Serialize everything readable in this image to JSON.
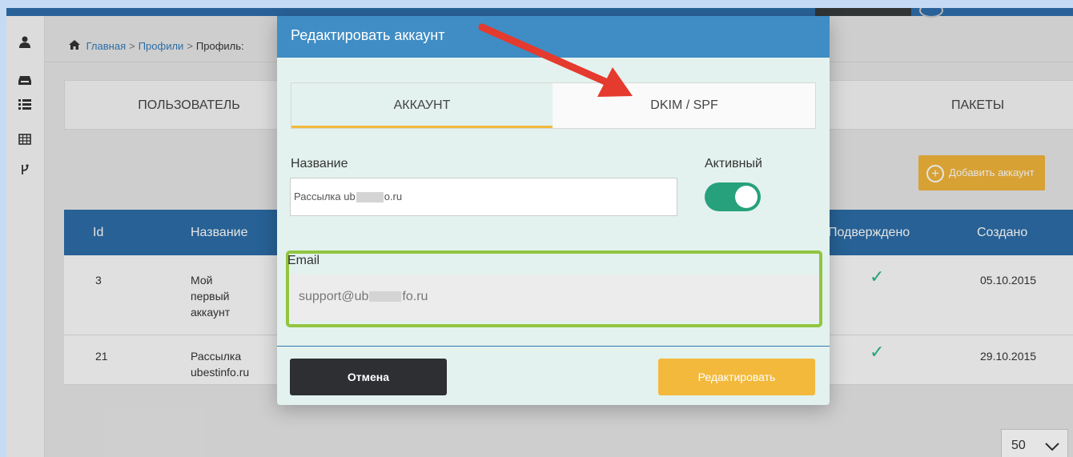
{
  "breadcrumb": {
    "home": "Главная",
    "sep": ">",
    "profiles": "Профили",
    "current": "Профиль:"
  },
  "page_tabs": {
    "user": "ПОЛЬЗОВАТЕЛЬ",
    "packages": "ПАКЕТЫ"
  },
  "add_button": {
    "icon": "plus-circle-icon",
    "label": "Добавить аккаунт"
  },
  "table": {
    "headers": {
      "id": "Id",
      "name": "Название",
      "confirmed": "Подверждено",
      "created": "Создано"
    },
    "rows": [
      {
        "id": "3",
        "name_lines": [
          "Мой",
          "первый",
          "аккаунт"
        ],
        "confirmed": "✓",
        "created": "05.10.2015"
      },
      {
        "id": "21",
        "name_lines": [
          "Рассылка",
          "ubestinfo.ru"
        ],
        "confirmed": "✓",
        "created": "29.10.2015"
      }
    ]
  },
  "pager": {
    "value": "50",
    "icon": "chevron-down-icon"
  },
  "modal": {
    "title": "Редактировать аккаунт",
    "tabs": [
      {
        "label": "АККАУНТ",
        "active": true
      },
      {
        "label": "DKIM / SPF",
        "active": false
      }
    ],
    "name_label": "Название",
    "name_value_pre": "Рассылка ub",
    "name_value_post": "o.ru",
    "active_label": "Активный",
    "active": true,
    "email_label": "Email",
    "email_value_pre": "support@ub",
    "email_value_post": "fo.ru",
    "cancel_label": "Отмена",
    "submit_label": "Редактировать"
  },
  "colors": {
    "accent": "#3f8dc4",
    "table_head": "#2c6da6",
    "yellow": "#f3b93c",
    "green": "#26a17c",
    "highlight": "#92c540",
    "arrow": "#e53a2e"
  }
}
